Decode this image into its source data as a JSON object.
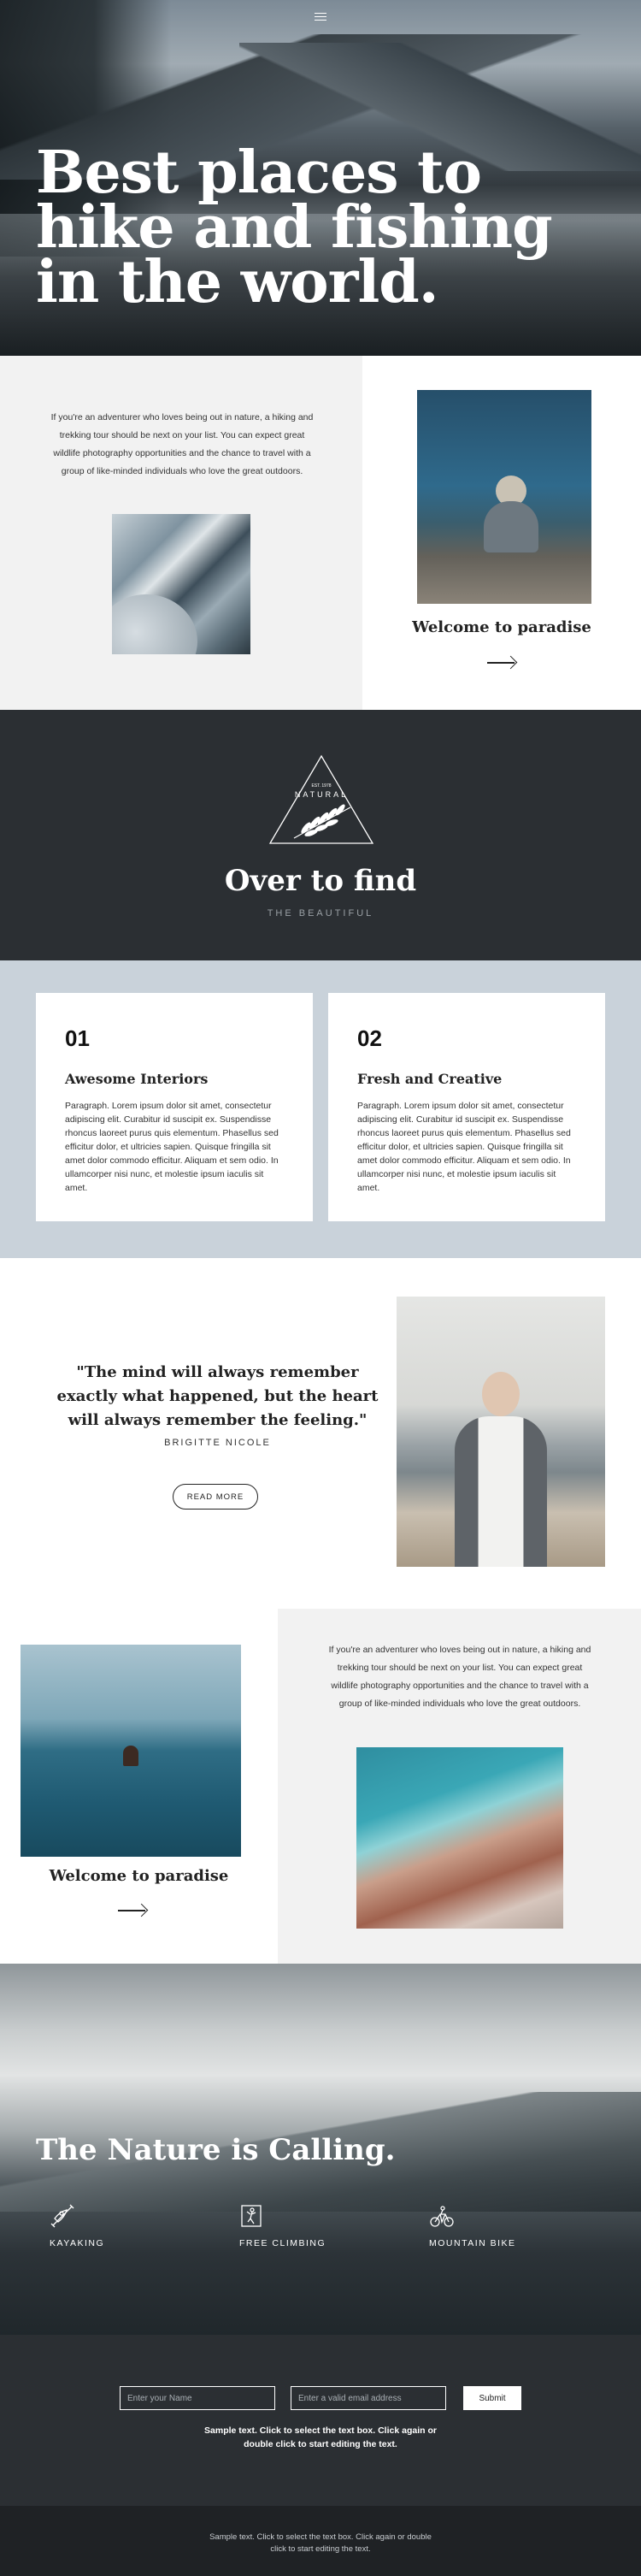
{
  "hero": {
    "title": "Best places to hike and fishing in the world.",
    "menu_icon": "hamburger-menu-icon"
  },
  "section_intro": {
    "paragraph": "If you're an adventurer who loves being out in nature, a hiking and trekking tour should be next on your list. You can expect great wildlife photography opportunities and the chance to travel with a group of like-minded individuals who love the great outdoors.",
    "card_title": "Welcome to paradise"
  },
  "brand": {
    "logo_top": "EST. 1978",
    "logo_text": "NATURAL",
    "heading": "Over to find",
    "subheading": "THE BEAUTIFUL"
  },
  "features": [
    {
      "number": "01",
      "title": "Awesome Interiors",
      "text": "Paragraph. Lorem ipsum dolor sit amet, consectetur adipiscing elit. Curabitur id suscipit ex. Suspendisse rhoncus laoreet purus quis elementum. Phasellus sed efficitur dolor, et ultricies sapien. Quisque fringilla sit amet dolor commodo efficitur. Aliquam et sem odio. In ullamcorper nisi nunc, et molestie ipsum iaculis sit amet."
    },
    {
      "number": "02",
      "title": "Fresh and Creative",
      "text": "Paragraph. Lorem ipsum dolor sit amet, consectetur adipiscing elit. Curabitur id suscipit ex. Suspendisse rhoncus laoreet purus quis elementum. Phasellus sed efficitur dolor, et ultricies sapien. Quisque fringilla sit amet dolor commodo efficitur. Aliquam et sem odio. In ullamcorper nisi nunc, et molestie ipsum iaculis sit amet."
    }
  ],
  "testimonial": {
    "quote": "\"The mind will always remember exactly what happened, but the heart will always remember the feeling.\"",
    "author": "BRIGITTE NICOLE",
    "button_label": "READ MORE"
  },
  "section_second": {
    "card_title": "Welcome to paradise",
    "paragraph": "If you're an adventurer who loves being out in nature, a hiking and trekking tour should be next on your list. You can expect great wildlife photography opportunities and the chance to travel with a group of like-minded individuals who love the great outdoors."
  },
  "nature": {
    "heading": "The Nature is Calling.",
    "items": [
      {
        "label": "KAYAKING",
        "icon": "kayak-icon"
      },
      {
        "label": "FREE CLIMBING",
        "icon": "climbing-icon"
      },
      {
        "label": "MOUNTAIN BIKE",
        "icon": "bike-icon"
      }
    ]
  },
  "form": {
    "name_placeholder": "Enter your Name",
    "email_placeholder": "Enter a valid email address",
    "submit_label": "Submit",
    "note": "Sample text. Click to select the text box. Click again or double click to start editing the text."
  },
  "footer": {
    "note": "Sample text. Click to select the text box. Click again or double click to start editing the text."
  },
  "colors": {
    "dark": "#2b2f33",
    "light_gray": "#f2f2f2",
    "blue_gray": "#c9d2da",
    "footer": "#1f2225"
  }
}
